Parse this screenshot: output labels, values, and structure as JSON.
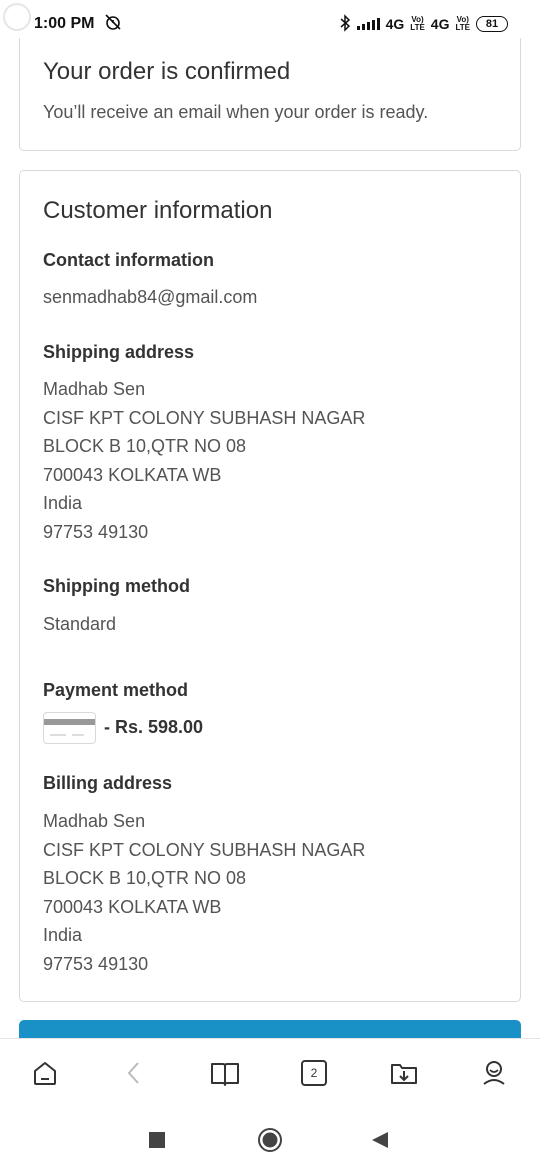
{
  "status_bar": {
    "time": "1:00 PM",
    "network_1": "4G",
    "network_2": "4G",
    "battery": "81"
  },
  "confirmation": {
    "title": "Your order is confirmed",
    "message": "You’ll receive an email when your order is ready."
  },
  "customer_info": {
    "title": "Customer information",
    "contact": {
      "label": "Contact information",
      "email": "senmadhab84@gmail.com"
    },
    "shipping_address": {
      "label": "Shipping address",
      "lines": [
        "Madhab Sen",
        "CISF KPT COLONY SUBHASH NAGAR",
        "BLOCK B 10,QTR NO 08",
        "700043 KOLKATA WB",
        "India",
        "97753 49130"
      ]
    },
    "shipping_method": {
      "label": "Shipping method",
      "value": "Standard"
    },
    "payment_method": {
      "label": "Payment method",
      "amount": "- Rs. 598.00",
      "icon": "credit-card-icon"
    },
    "billing_address": {
      "label": "Billing address",
      "lines": [
        "Madhab Sen",
        "CISF KPT COLONY SUBHASH NAGAR",
        "BLOCK B 10,QTR NO 08",
        "700043 KOLKATA WB",
        "India",
        "97753 49130"
      ]
    }
  },
  "toolbar": {
    "tab_count": "2",
    "icons": [
      "home-icon",
      "back-icon",
      "bookmarks-icon",
      "tabs-icon",
      "downloads-icon",
      "profile-icon"
    ]
  },
  "colors": {
    "accent": "#1990c6",
    "border": "#d9d9d9",
    "text": "#333333",
    "muted_text": "#545454"
  }
}
